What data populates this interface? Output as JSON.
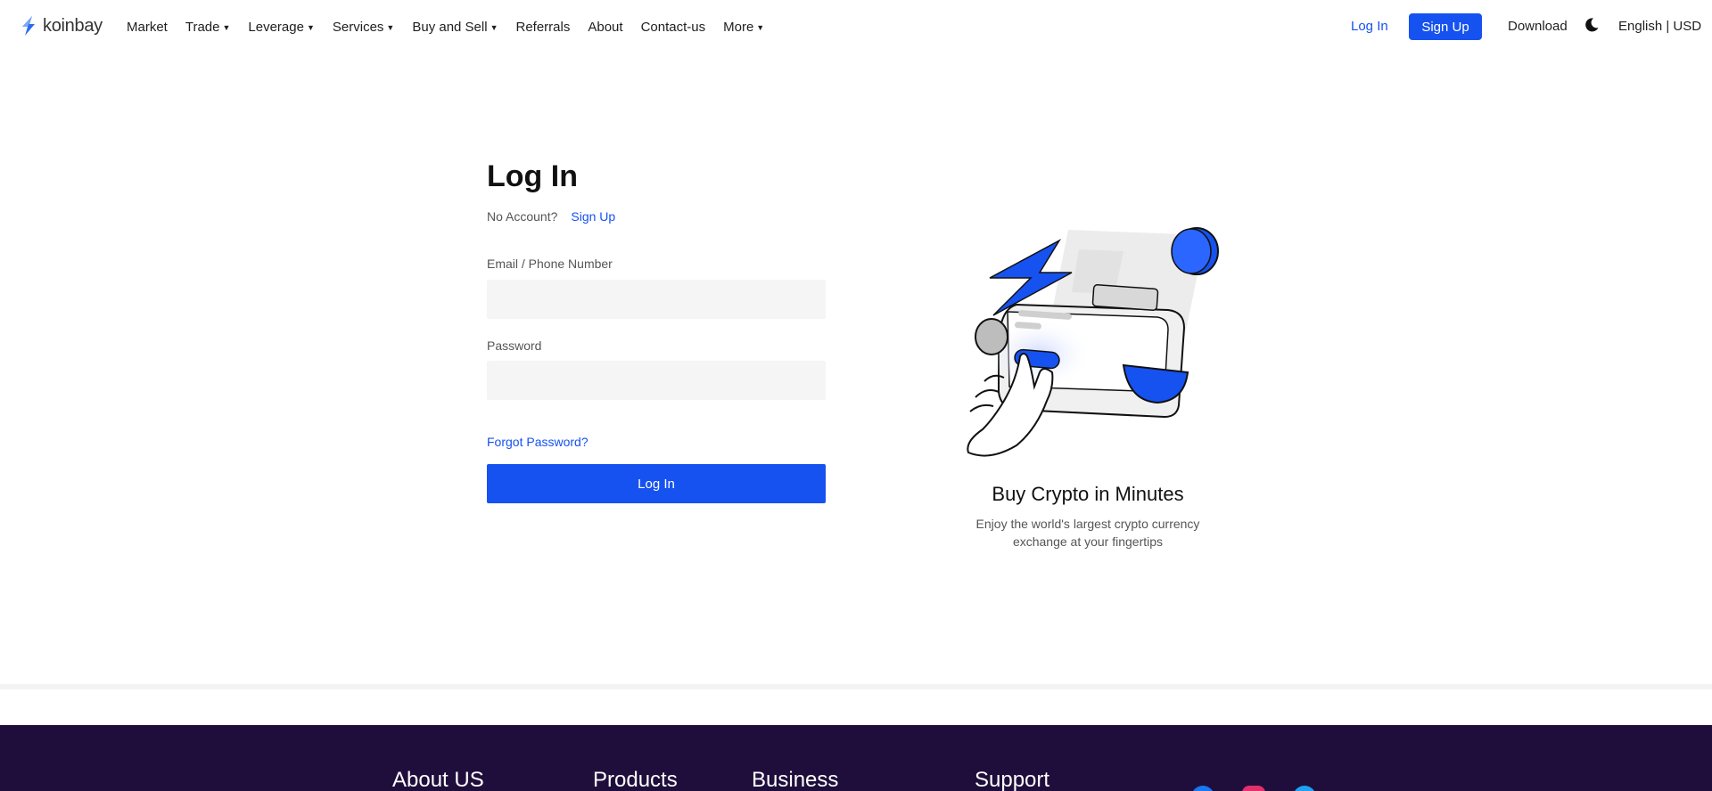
{
  "brand": {
    "name": "koinbay"
  },
  "nav": {
    "items": [
      {
        "label": "Market",
        "dropdown": false
      },
      {
        "label": "Trade",
        "dropdown": true
      },
      {
        "label": "Leverage",
        "dropdown": true
      },
      {
        "label": "Services",
        "dropdown": true
      },
      {
        "label": "Buy and Sell",
        "dropdown": true
      },
      {
        "label": "Referrals",
        "dropdown": false
      },
      {
        "label": "About",
        "dropdown": false
      },
      {
        "label": "Contact-us",
        "dropdown": false
      },
      {
        "label": "More",
        "dropdown": true
      }
    ],
    "login_label": "Log In",
    "signup_label": "Sign Up",
    "download_label": "Download",
    "theme_icon": "moon-icon",
    "lang_label": "English | USD"
  },
  "login": {
    "title": "Log In",
    "no_account": "No Account?",
    "signup_link": "Sign Up",
    "email_label": "Email / Phone Number",
    "email_value": "",
    "password_label": "Password",
    "password_value": "",
    "forgot": "Forgot Password?",
    "submit": "Log In"
  },
  "promo": {
    "title": "Buy Crypto in Minutes",
    "subtitle": "Enjoy the world's largest crypto currency exchange at your fingertips"
  },
  "footer": {
    "columns": [
      "About US",
      "Products",
      "Business",
      "Support"
    ]
  },
  "colors": {
    "accent": "#1652f0",
    "footer_bg": "#1f0e3b",
    "input_bg": "#f5f5f5"
  }
}
